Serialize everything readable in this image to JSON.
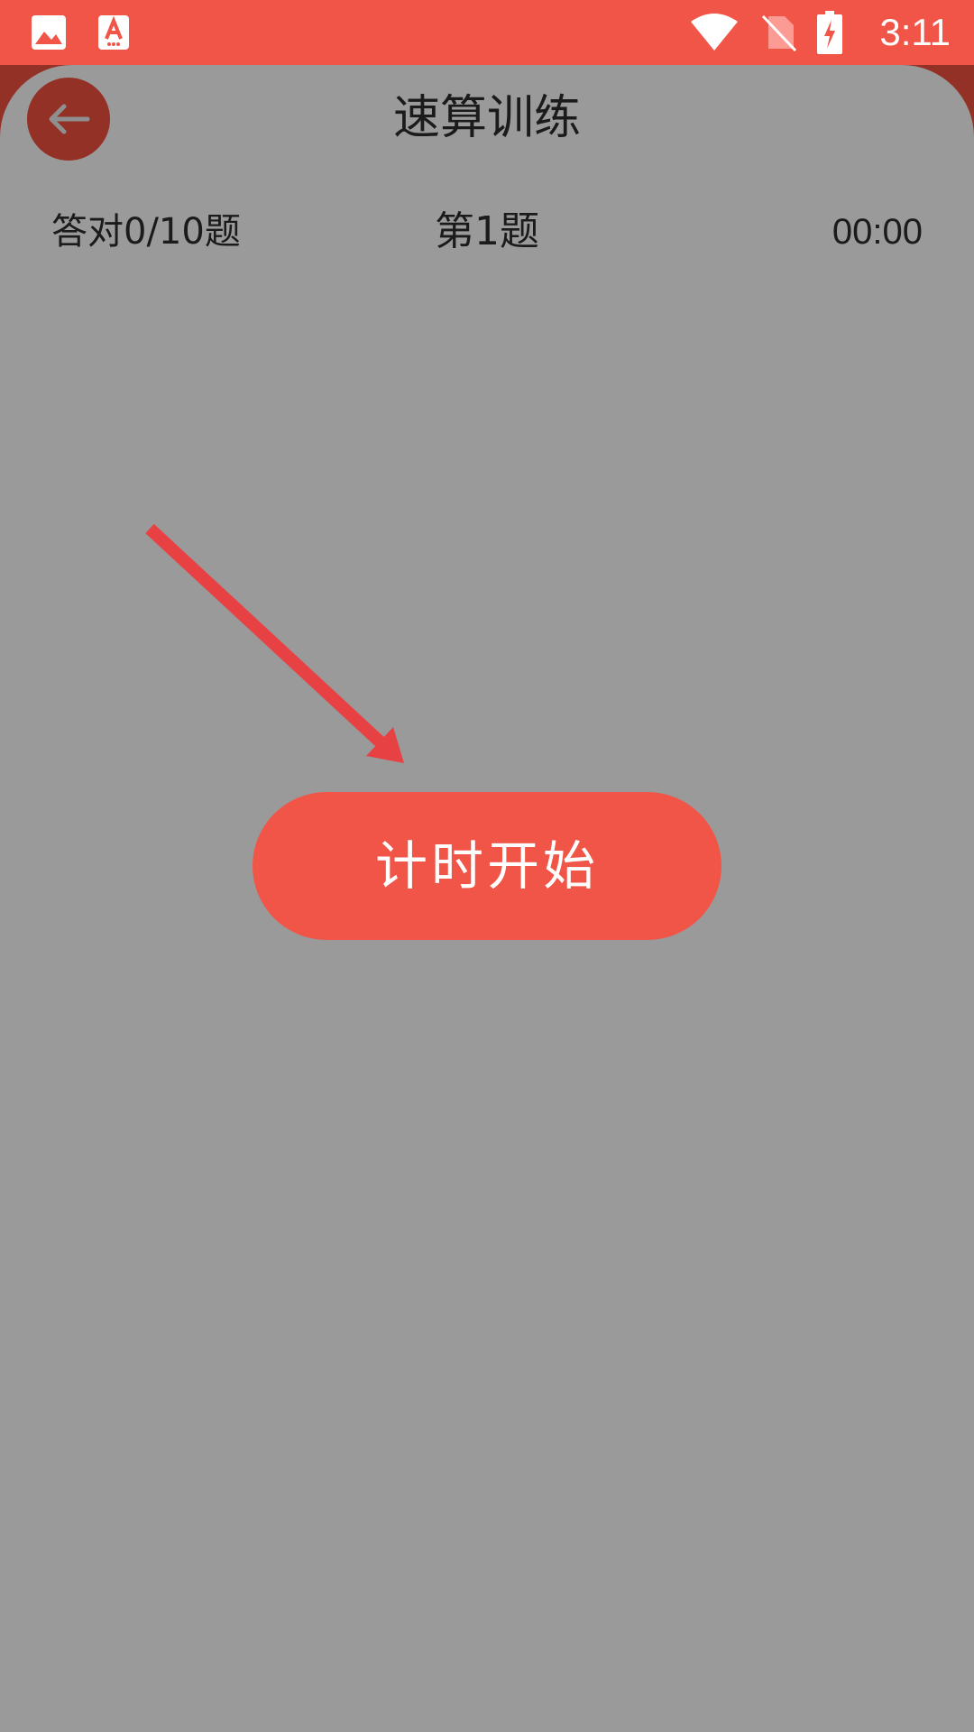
{
  "status_bar": {
    "time": "3:11",
    "icons": [
      "image-notification-icon",
      "font-app-notification-icon",
      "wifi-icon",
      "no-sim-icon",
      "battery-charging-icon"
    ]
  },
  "header": {
    "title": "速算训练",
    "back_icon": "arrow-left-icon"
  },
  "stats": {
    "correct": "答对0/10题",
    "question": "第1题",
    "timer": "00:00"
  },
  "actions": {
    "start_label": "计时开始"
  },
  "colors": {
    "accent": "#F05547",
    "dark_accent": "#933127",
    "overlay_gray": "#9A9A9A",
    "annotation_arrow": "#E84144"
  }
}
